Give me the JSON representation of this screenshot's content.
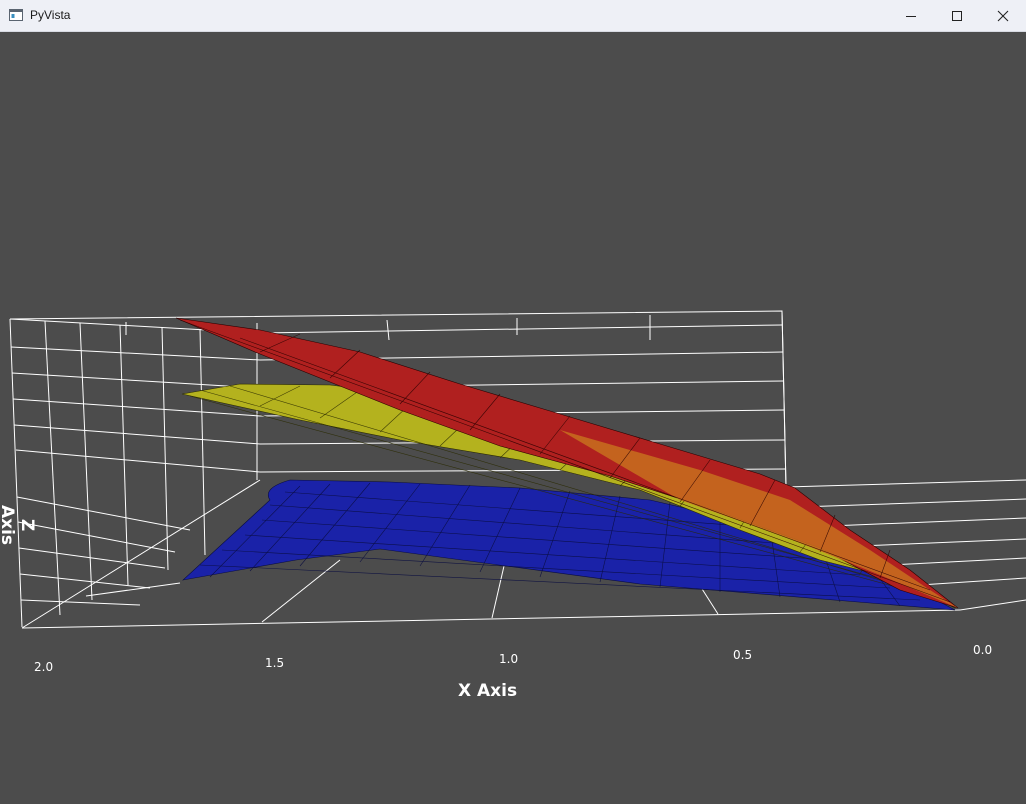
{
  "window": {
    "title": "PyVista",
    "icon": "app-window-icon",
    "controls": [
      "minimize-icon",
      "maximize-icon",
      "close-icon"
    ]
  },
  "plot": {
    "background": "#4c4c4c",
    "x_axis_label": "X Axis",
    "z_axis_label": "Z Axis",
    "x_ticks": [
      "2.0",
      "1.5",
      "1.0",
      "0.5",
      "0.0"
    ],
    "surfaces": [
      {
        "color": "#b4b21e",
        "role": "middle surface"
      },
      {
        "color": "#1a22a8",
        "role": "bottom surface"
      },
      {
        "color": "#b0201f",
        "role": "top surface"
      }
    ]
  }
}
